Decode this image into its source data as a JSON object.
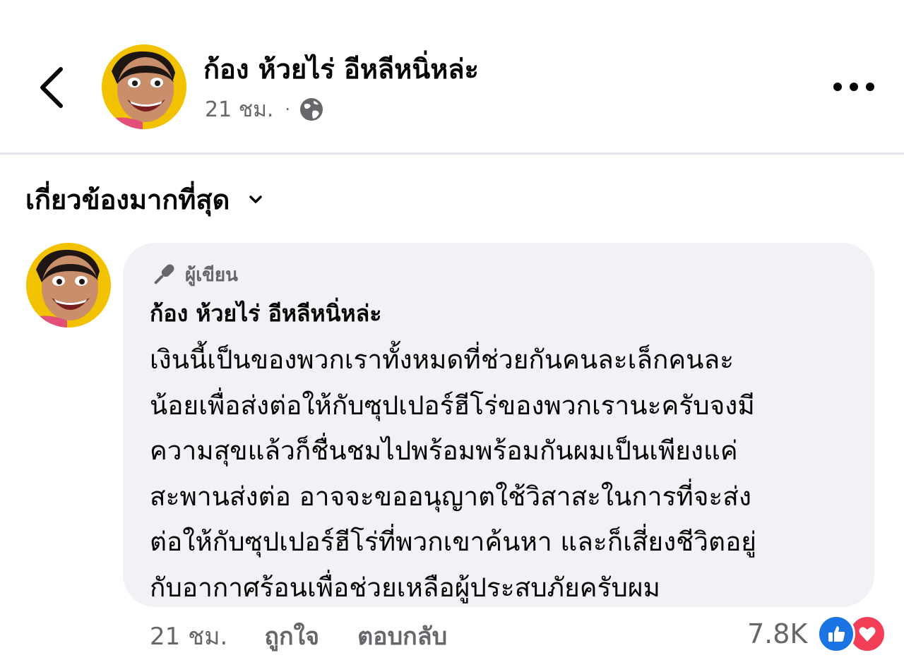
{
  "post": {
    "author_name": "ก้อง ห้วยไร่ อีหลีหนิ่หล่ะ",
    "time": "21 ชม.",
    "separator": "·",
    "privacy_icon": "globe-icon"
  },
  "header": {
    "back_icon": "chevron-left-icon",
    "more_icon": "more-options-icon"
  },
  "sort": {
    "label": "เกี่ยวข้องมากที่สุด",
    "icon": "chevron-down-icon"
  },
  "comment": {
    "badge_label": "ผู้เขียน",
    "badge_icon": "microphone-icon",
    "author_name": "ก้อง ห้วยไร่ อีหลีหนิ่หล่ะ",
    "text_lines": [
      "เงินนี้เป็นของพวกเราทั้งหมดที่ช่วยกันคนละเล็กคนละ",
      "น้อยเพื่อส่งต่อให้กับซุปเปอร์ฮีโร่ของพวกเรานะครับจงมี",
      "ความสุขแล้วก็ชื่นชมไปพร้อมพร้อมกันผมเป็นเพียงแค่",
      "สะพานส่งต่อ อาจจะขออนุญาตใช้วิสาสะในการที่จะส่ง",
      "ต่อให้กับซุปเปอร์ฮีโร่ที่พวกเขาค้นหา และก็เสี่ยงชีวิตอยู่",
      "กับอากาศร้อนเพื่อช่วยเหลือผู้ประสบภัยครับผม"
    ],
    "time": "21 ชม.",
    "like_label": "ถูกใจ",
    "reply_label": "ตอบกลับ",
    "reaction_count": "7.8K",
    "reaction_icons": [
      "like-reaction-icon",
      "love-reaction-icon"
    ]
  },
  "colors": {
    "secondary_text": "#65676b",
    "bubble_bg": "#f0f2f5",
    "like_blue": "#1b74e4",
    "love_red": "#f33e58",
    "avatar_yellow": "#f2c200"
  }
}
